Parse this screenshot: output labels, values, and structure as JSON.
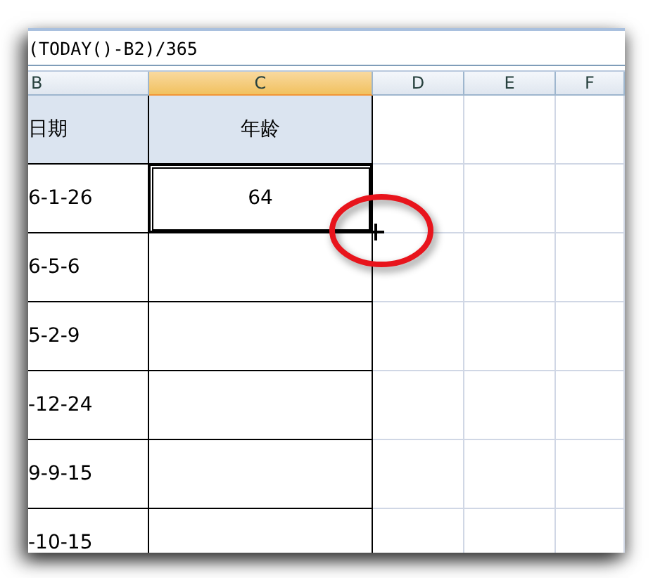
{
  "formula_bar": {
    "text": "(TODAY()-B2)/365"
  },
  "columns": [
    {
      "label": "B",
      "selected": false
    },
    {
      "label": "C",
      "selected": true
    },
    {
      "label": "D",
      "selected": false
    },
    {
      "label": "E",
      "selected": false
    },
    {
      "label": "F",
      "selected": false
    }
  ],
  "rows": [
    {
      "kind": "header",
      "cells": [
        "日期",
        "年龄"
      ]
    },
    {
      "kind": "data",
      "cells": [
        "6-1-26",
        "64"
      ],
      "selected": true
    },
    {
      "kind": "data",
      "cells": [
        "6-5-6",
        ""
      ],
      "selected": false
    },
    {
      "kind": "data",
      "cells": [
        "5-2-9",
        ""
      ],
      "selected": false
    },
    {
      "kind": "data",
      "cells": [
        "-12-24",
        ""
      ],
      "selected": false
    },
    {
      "kind": "data",
      "cells": [
        "9-9-15",
        ""
      ],
      "selected": false
    },
    {
      "kind": "data",
      "cells": [
        "-10-15",
        ""
      ],
      "selected": false
    }
  ]
}
